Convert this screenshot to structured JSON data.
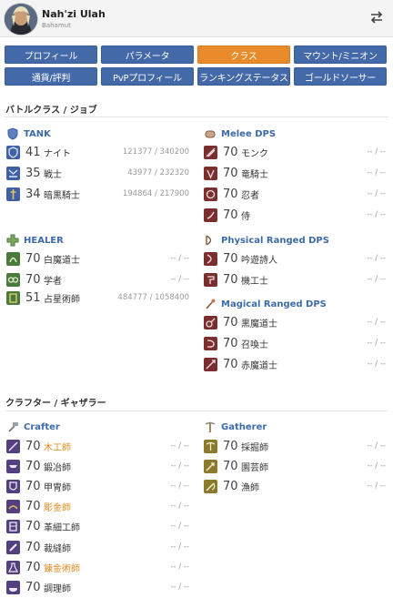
{
  "header": {
    "name": "Nah'zi Ulah",
    "world": "Bahamut"
  },
  "tabs": [
    {
      "label": "プロフィール"
    },
    {
      "label": "パラメータ"
    },
    {
      "label": "クラス"
    },
    {
      "label": "マウント/ミニオン"
    },
    {
      "label": "通貨/評判"
    },
    {
      "label": "PvPプロフィール"
    },
    {
      "label": "ランキングステータス"
    },
    {
      "label": "ゴールドソーサー"
    }
  ],
  "battle": {
    "title": "バトルクラス / ジョブ",
    "tank": {
      "head": "TANK",
      "jobs": [
        {
          "level": "41",
          "name": "ナイト",
          "exp": "121377 / 340200"
        },
        {
          "level": "35",
          "name": "戦士",
          "exp": "43977 / 232320"
        },
        {
          "level": "34",
          "name": "暗黒騎士",
          "exp": "194864 / 217900"
        }
      ]
    },
    "healer": {
      "head": "HEALER",
      "jobs": [
        {
          "level": "70",
          "name": "白魔道士",
          "exp": "-- / --"
        },
        {
          "level": "70",
          "name": "学者",
          "exp": "-- / --"
        },
        {
          "level": "51",
          "name": "占星術師",
          "exp": "484777 / 1058400"
        }
      ]
    },
    "melee": {
      "head": "Melee DPS",
      "jobs": [
        {
          "level": "70",
          "name": "モンク",
          "exp": "-- / --"
        },
        {
          "level": "70",
          "name": "竜騎士",
          "exp": "-- / --"
        },
        {
          "level": "70",
          "name": "忍者",
          "exp": "-- / --"
        },
        {
          "level": "70",
          "name": "侍",
          "exp": "-- / --"
        }
      ]
    },
    "ranged": {
      "head": "Physical Ranged DPS",
      "jobs": [
        {
          "level": "70",
          "name": "吟遊詩人",
          "exp": "-- / --"
        },
        {
          "level": "70",
          "name": "機工士",
          "exp": "-- / --"
        }
      ]
    },
    "magic": {
      "head": "Magical Ranged DPS",
      "jobs": [
        {
          "level": "70",
          "name": "黒魔道士",
          "exp": "-- / --"
        },
        {
          "level": "70",
          "name": "召喚士",
          "exp": "-- / --"
        },
        {
          "level": "70",
          "name": "赤魔道士",
          "exp": "-- / --"
        }
      ]
    }
  },
  "crafting": {
    "title": "クラフター / ギャザラー",
    "crafter": {
      "head": "Crafter",
      "jobs": [
        {
          "level": "70",
          "name": "木工師",
          "exp": "-- / --",
          "highlight": true
        },
        {
          "level": "70",
          "name": "鍛冶師",
          "exp": "-- / --",
          "highlight": false
        },
        {
          "level": "70",
          "name": "甲冑師",
          "exp": "-- / --",
          "highlight": false
        },
        {
          "level": "70",
          "name": "彫金師",
          "exp": "-- / --",
          "highlight": true
        },
        {
          "level": "70",
          "name": "革細工師",
          "exp": "-- / --",
          "highlight": false
        },
        {
          "level": "70",
          "name": "裁縫師",
          "exp": "-- / --",
          "highlight": false
        },
        {
          "level": "70",
          "name": "錬金術師",
          "exp": "-- / --",
          "highlight": true
        },
        {
          "level": "70",
          "name": "調理師",
          "exp": "-- / --",
          "highlight": false
        }
      ]
    },
    "gatherer": {
      "head": "Gatherer",
      "jobs": [
        {
          "level": "70",
          "name": "採掘師",
          "exp": "-- / --"
        },
        {
          "level": "70",
          "name": "園芸師",
          "exp": "-- / --"
        },
        {
          "level": "70",
          "name": "漁師",
          "exp": "-- / --"
        }
      ]
    }
  },
  "colors": {
    "tab": "#4469a8",
    "tab_active": "#e98b2a",
    "group_heading": "#3d6aa8",
    "tank_icon": "#3f5fa6",
    "healer_icon": "#4b7a3a",
    "dps_icon": "#7a2e2e",
    "crafter_icon": "#54407e",
    "gatherer_icon": "#8a7a2a",
    "highlight_text": "#e08a1e"
  },
  "icons": {
    "switch": "swap-arrows-icon",
    "tank": "shield-icon",
    "healer": "cross-icon",
    "melee": "fist-icon",
    "ranged": "bow-icon",
    "magic": "staff-icon",
    "crafter": "hammer-icon",
    "gatherer": "pickaxe-icon"
  }
}
